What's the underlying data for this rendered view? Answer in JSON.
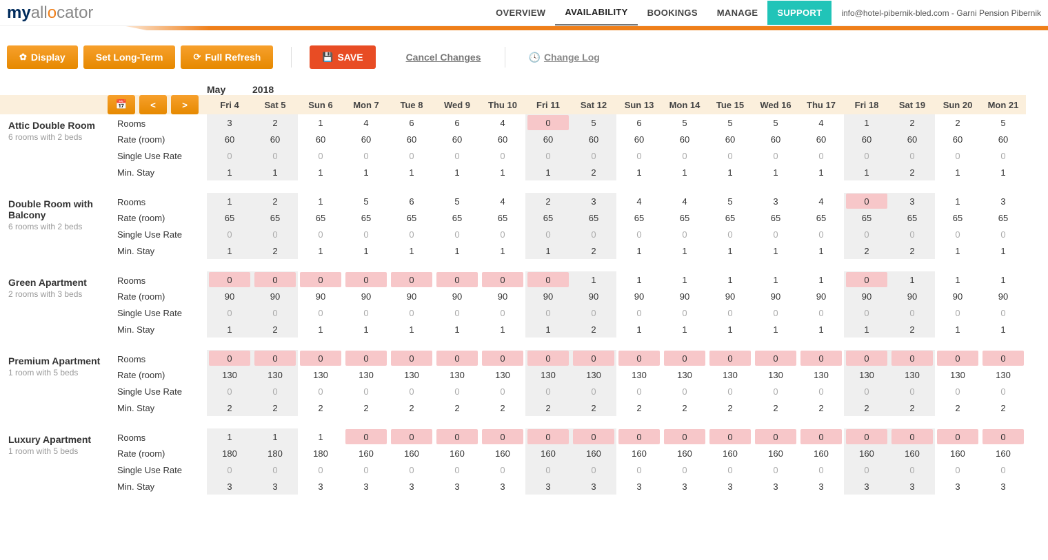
{
  "header": {
    "logo": {
      "my": "my",
      "allo": "all",
      "c": "o",
      "cator": "cator"
    },
    "nav": [
      "OVERVIEW",
      "AVAILABILITY",
      "BOOKINGS",
      "MANAGE",
      "SUPPORT"
    ],
    "active_nav": "AVAILABILITY",
    "user_email": "info@hotel-pibernik-bled.com",
    "user_property": "Garni Pension Pibernik"
  },
  "toolbar": {
    "display": "Display",
    "setlongterm": "Set Long-Term",
    "fullrefresh": "Full Refresh",
    "save": "SAVE",
    "cancel": "Cancel Changes",
    "changelog": "Change Log"
  },
  "calendar": {
    "month": "May",
    "year": "2018",
    "days": [
      {
        "label": "Fri 4",
        "weekend": true
      },
      {
        "label": "Sat 5",
        "weekend": true
      },
      {
        "label": "Sun 6",
        "weekend": false
      },
      {
        "label": "Mon 7",
        "weekend": false
      },
      {
        "label": "Tue 8",
        "weekend": false
      },
      {
        "label": "Wed 9",
        "weekend": false
      },
      {
        "label": "Thu 10",
        "weekend": false
      },
      {
        "label": "Fri 11",
        "weekend": true
      },
      {
        "label": "Sat 12",
        "weekend": true
      },
      {
        "label": "Sun 13",
        "weekend": false
      },
      {
        "label": "Mon 14",
        "weekend": false
      },
      {
        "label": "Tue 15",
        "weekend": false
      },
      {
        "label": "Wed 16",
        "weekend": false
      },
      {
        "label": "Thu 17",
        "weekend": false
      },
      {
        "label": "Fri 18",
        "weekend": true
      },
      {
        "label": "Sat 19",
        "weekend": true
      },
      {
        "label": "Sun 20",
        "weekend": false
      },
      {
        "label": "Mon 21",
        "weekend": false
      }
    ],
    "row_labels": [
      "Rooms",
      "Rate (room)",
      "Single Use Rate",
      "Min. Stay"
    ],
    "rooms": [
      {
        "name": "Attic Double Room",
        "sub": "6 rooms with 2 beds",
        "rows": [
          [
            3,
            2,
            1,
            4,
            6,
            6,
            4,
            0,
            5,
            6,
            5,
            5,
            5,
            4,
            1,
            2,
            2,
            5
          ],
          [
            60,
            60,
            60,
            60,
            60,
            60,
            60,
            60,
            60,
            60,
            60,
            60,
            60,
            60,
            60,
            60,
            60,
            60
          ],
          [
            0,
            0,
            0,
            0,
            0,
            0,
            0,
            0,
            0,
            0,
            0,
            0,
            0,
            0,
            0,
            0,
            0,
            0
          ],
          [
            1,
            1,
            1,
            1,
            1,
            1,
            1,
            1,
            2,
            1,
            1,
            1,
            1,
            1,
            1,
            2,
            1,
            1
          ]
        ]
      },
      {
        "name": "Double Room with Balcony",
        "sub": "6 rooms with 2 beds",
        "rows": [
          [
            1,
            2,
            1,
            5,
            6,
            5,
            4,
            2,
            3,
            4,
            4,
            5,
            3,
            4,
            0,
            3,
            1,
            3
          ],
          [
            65,
            65,
            65,
            65,
            65,
            65,
            65,
            65,
            65,
            65,
            65,
            65,
            65,
            65,
            65,
            65,
            65,
            65
          ],
          [
            0,
            0,
            0,
            0,
            0,
            0,
            0,
            0,
            0,
            0,
            0,
            0,
            0,
            0,
            0,
            0,
            0,
            0
          ],
          [
            1,
            2,
            1,
            1,
            1,
            1,
            1,
            1,
            2,
            1,
            1,
            1,
            1,
            1,
            2,
            2,
            1,
            1
          ]
        ]
      },
      {
        "name": "Green Apartment",
        "sub": "2 rooms with 3 beds",
        "rows": [
          [
            0,
            0,
            0,
            0,
            0,
            0,
            0,
            0,
            1,
            1,
            1,
            1,
            1,
            1,
            0,
            1,
            1,
            1
          ],
          [
            90,
            90,
            90,
            90,
            90,
            90,
            90,
            90,
            90,
            90,
            90,
            90,
            90,
            90,
            90,
            90,
            90,
            90
          ],
          [
            0,
            0,
            0,
            0,
            0,
            0,
            0,
            0,
            0,
            0,
            0,
            0,
            0,
            0,
            0,
            0,
            0,
            0
          ],
          [
            1,
            2,
            1,
            1,
            1,
            1,
            1,
            1,
            2,
            1,
            1,
            1,
            1,
            1,
            1,
            2,
            1,
            1
          ]
        ]
      },
      {
        "name": "Premium Apartment",
        "sub": "1 room with 5 beds",
        "rows": [
          [
            0,
            0,
            0,
            0,
            0,
            0,
            0,
            0,
            0,
            0,
            0,
            0,
            0,
            0,
            0,
            0,
            0,
            0
          ],
          [
            130,
            130,
            130,
            130,
            130,
            130,
            130,
            130,
            130,
            130,
            130,
            130,
            130,
            130,
            130,
            130,
            130,
            130
          ],
          [
            0,
            0,
            0,
            0,
            0,
            0,
            0,
            0,
            0,
            0,
            0,
            0,
            0,
            0,
            0,
            0,
            0,
            0
          ],
          [
            2,
            2,
            2,
            2,
            2,
            2,
            2,
            2,
            2,
            2,
            2,
            2,
            2,
            2,
            2,
            2,
            2,
            2
          ]
        ]
      },
      {
        "name": "Luxury Apartment",
        "sub": "1 room with 5 beds",
        "rows": [
          [
            1,
            1,
            1,
            0,
            0,
            0,
            0,
            0,
            0,
            0,
            0,
            0,
            0,
            0,
            0,
            0,
            0,
            0
          ],
          [
            180,
            180,
            180,
            160,
            160,
            160,
            160,
            160,
            160,
            160,
            160,
            160,
            160,
            160,
            160,
            160,
            160,
            160
          ],
          [
            0,
            0,
            0,
            0,
            0,
            0,
            0,
            0,
            0,
            0,
            0,
            0,
            0,
            0,
            0,
            0,
            0,
            0
          ],
          [
            3,
            3,
            3,
            3,
            3,
            3,
            3,
            3,
            3,
            3,
            3,
            3,
            3,
            3,
            3,
            3,
            3,
            3
          ]
        ]
      }
    ]
  }
}
